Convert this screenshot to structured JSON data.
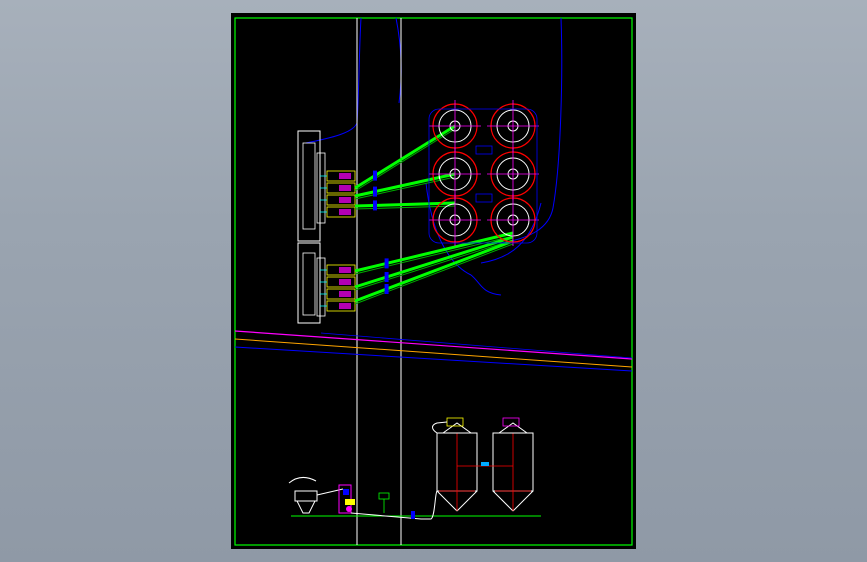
{
  "viewer": {
    "background_top": "#a7b0bb",
    "background_bottom": "#8f99a6"
  },
  "drawing": {
    "sheet_color": "#000000",
    "frame_color": "#00ff00",
    "colors": {
      "road": "#0000ff",
      "conveyor": "#00ff00",
      "conveyor_dark": "#00aa00",
      "silo_outline": "#ffffff",
      "silo_core": "#ff0000",
      "axis": "#ff00ff",
      "pipe": "#ffa500",
      "equipment": "#ffff00",
      "cyan": "#00ffff"
    },
    "silo_labels": [],
    "annotations": []
  }
}
